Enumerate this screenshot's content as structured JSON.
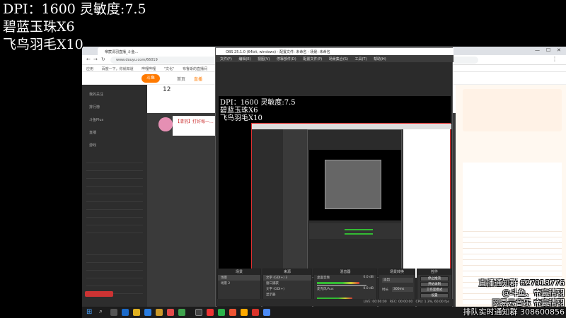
{
  "overlay": {
    "line1": "DPI：1600 灵敏度:7.5",
    "line2": "碧蓝玉珠X6",
    "line3": "飞鸟羽毛X10"
  },
  "overlay_mini": {
    "line1": "DPI：1600 灵敏度:7.5",
    "line2": "碧蓝玉珠X6",
    "line3": "飞鸟羽毛X10"
  },
  "right_overlay": {
    "l1": "直播通知群 627918776",
    "l2": "@斗鱼、帝宸清羽",
    "l3": "网易云音乐 帝宸清羽",
    "l4": "排队实时通知群 308600856"
  },
  "browser": {
    "tab_title": "帝宸清羽直播_斗鱼...",
    "address": "www.douyu.com/66019",
    "bookmarks": [
      "应用",
      "百度一下，你就知道",
      "哔哩哔哩",
      "\"文化\"",
      "布鲁斯的直播间"
    ],
    "nav": [
      "首页",
      "直播"
    ],
    "logo": "斗鱼",
    "sidebar_items": [
      "我的关注",
      "排行榜",
      "斗鱼Plus",
      "直播",
      "游戏"
    ],
    "streamer_title": "【清羽】打好每一...",
    "follow_count": "12"
  },
  "obs": {
    "title": "OBS 25.1.0 (64bit, windows) - 配置文件: 未命名 - 场景: 未命名",
    "menu": [
      "文件(F)",
      "编辑(E)",
      "视图(V)",
      "停靠部件(D)",
      "配置文件(P)",
      "场景集合(S)",
      "工具(T)",
      "帮助(H)"
    ],
    "docks": {
      "scenes": "场景",
      "sources": "来源",
      "mixer": "混音器",
      "transitions": "场景转换",
      "controls": "控件"
    },
    "scene_items": [
      "场景",
      "场景 2"
    ],
    "source_items": [
      "文字 (GDI+) 3",
      "窗口捕获",
      "文字 (GDI+)",
      "显示器"
    ],
    "mixer_items": [
      "桌面音频",
      "麦克风/Aux"
    ],
    "mixer_values": [
      "0.0 dB",
      "0.0 dB"
    ],
    "transition": "淡出",
    "duration_label": "时长",
    "duration": "300ms",
    "controls": [
      "停止推流",
      "开始录制",
      "工作室模式",
      "设置",
      "退出"
    ],
    "status": [
      "LIVE: 00:00:00",
      "REC: 00:00:00",
      "CPU: 1.3%, 60.00 fps"
    ]
  },
  "colors": {
    "obs_bg": "#2b2b2b",
    "douyu_orange": "#ff7a00",
    "preview_border": "#e03030"
  }
}
